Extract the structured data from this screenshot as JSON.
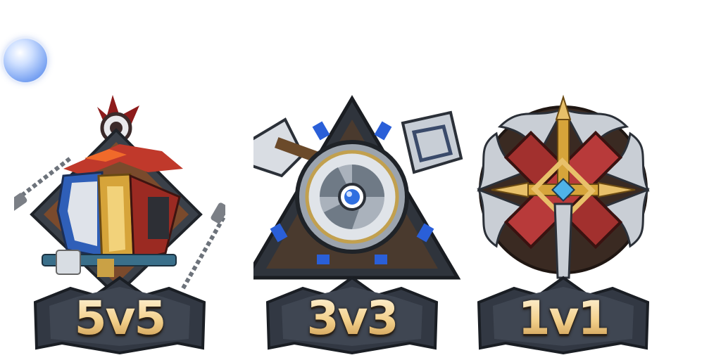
{
  "modes": [
    {
      "label": "5v5",
      "accent": "#c0392b"
    },
    {
      "label": "3v3",
      "accent": "#2f6fe0"
    },
    {
      "label": "1v1",
      "accent": "#b83a3a"
    }
  ],
  "colors": {
    "gold": "#e8c06a",
    "steel": "#9aa3ad",
    "dark_steel": "#2b3038",
    "orb": "#7aa3f2"
  }
}
